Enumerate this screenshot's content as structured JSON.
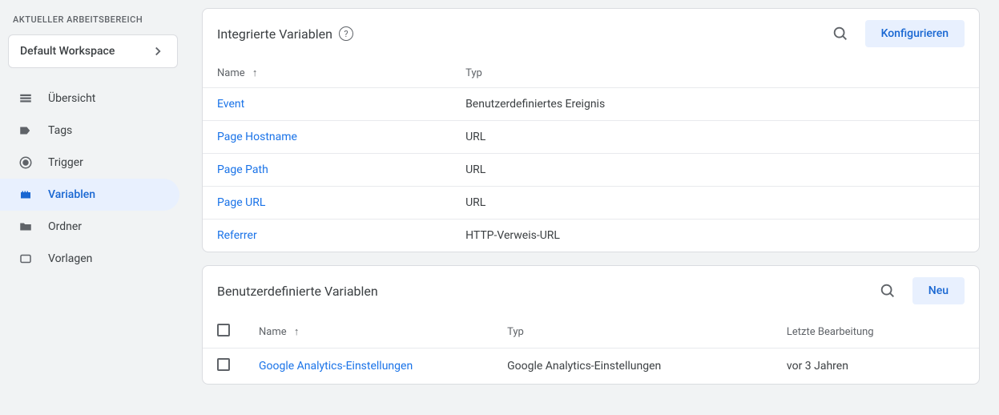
{
  "sidebar": {
    "workspace_label": "AKTUELLER ARBEITSBEREICH",
    "workspace_name": "Default Workspace",
    "nav": [
      {
        "icon": "overview",
        "label": "Übersicht",
        "active": false
      },
      {
        "icon": "tag",
        "label": "Tags",
        "active": false
      },
      {
        "icon": "trigger",
        "label": "Trigger",
        "active": false
      },
      {
        "icon": "variable",
        "label": "Variablen",
        "active": true
      },
      {
        "icon": "folder",
        "label": "Ordner",
        "active": false
      },
      {
        "icon": "template",
        "label": "Vorlagen",
        "active": false
      }
    ]
  },
  "builtin": {
    "title": "Integrierte Variablen",
    "configure_label": "Konfigurieren",
    "columns": {
      "name": "Name",
      "type": "Typ"
    },
    "rows": [
      {
        "name": "Event",
        "type": "Benutzerdefiniertes Ereignis"
      },
      {
        "name": "Page Hostname",
        "type": "URL"
      },
      {
        "name": "Page Path",
        "type": "URL"
      },
      {
        "name": "Page URL",
        "type": "URL"
      },
      {
        "name": "Referrer",
        "type": "HTTP-Verweis-URL"
      }
    ]
  },
  "custom": {
    "title": "Benutzerdefinierte Variablen",
    "new_label": "Neu",
    "columns": {
      "name": "Name",
      "type": "Typ",
      "edited": "Letzte Bearbeitung"
    },
    "rows": [
      {
        "name": "Google Analytics-Einstellungen",
        "type": "Google Analytics-Einstellungen",
        "edited": "vor 3 Jahren"
      }
    ]
  }
}
